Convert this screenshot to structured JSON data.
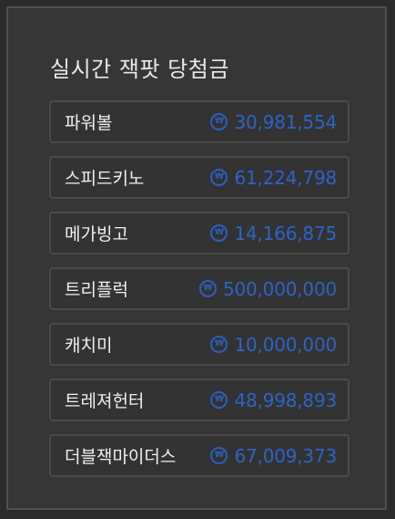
{
  "title": "실시간 잭팟 당첨금",
  "icon": {
    "name": "won-coin-icon",
    "glyph": "₩",
    "color": "#2b5fbf"
  },
  "jackpots": [
    {
      "name": "파워볼",
      "amount": "30,981,554"
    },
    {
      "name": "스피드키노",
      "amount": "61,224,798"
    },
    {
      "name": "메가빙고",
      "amount": "14,166,875"
    },
    {
      "name": "트리플럭",
      "amount": "500,000,000"
    },
    {
      "name": "캐치미",
      "amount": "10,000,000"
    },
    {
      "name": "트레져헌터",
      "amount": "48,998,893"
    },
    {
      "name": "더블잭마이더스",
      "amount": "67,009,373"
    }
  ]
}
